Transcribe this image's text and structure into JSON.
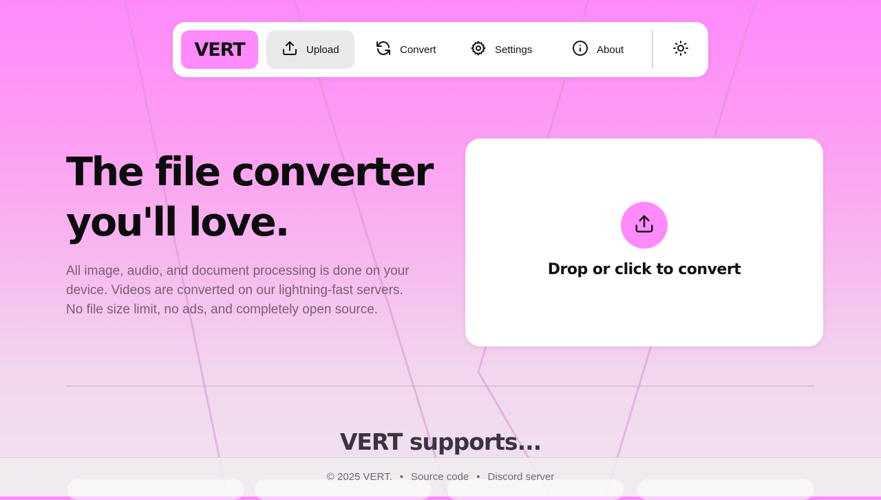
{
  "nav": {
    "logo": "VERT",
    "items": [
      {
        "label": "Upload",
        "icon": "upload-icon",
        "active": true
      },
      {
        "label": "Convert",
        "icon": "refresh-icon",
        "active": false
      },
      {
        "label": "Settings",
        "icon": "gear-icon",
        "active": false
      },
      {
        "label": "About",
        "icon": "info-icon",
        "active": false
      }
    ],
    "theme_toggle_icon": "sun-icon"
  },
  "hero": {
    "title_line1": "The file converter",
    "title_line2": "you'll love.",
    "description": "All image, audio, and document processing is done on your device. Videos are converted on our lightning-fast servers. No file size limit, no ads, and completely open source."
  },
  "dropzone": {
    "icon": "upload-icon",
    "label": "Drop or click to convert"
  },
  "supports": {
    "title": "VERT supports..."
  },
  "footer": {
    "copyright": "© 2025 VERT.",
    "links": [
      "Source code",
      "Discord server"
    ],
    "separator": "•"
  },
  "colors": {
    "accent": "#ff8afc",
    "nav_active_bg": "#e9e9e9",
    "text": "#111111",
    "muted_text": "#7a5f73"
  }
}
